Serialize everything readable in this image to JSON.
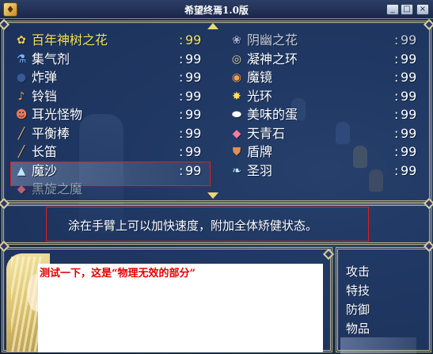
{
  "window": {
    "title": "希望终焉1.0版",
    "controls": [
      "_",
      "□",
      "×"
    ]
  },
  "items_left": [
    {
      "name": "百年神树之花",
      "count": "99",
      "icon": "flower-icon",
      "symbol": "✿",
      "state": "highlight"
    },
    {
      "name": "集气剂",
      "count": "99",
      "icon": "potion-icon",
      "symbol": "⚗",
      "state": "normal"
    },
    {
      "name": "炸弹",
      "count": "99",
      "icon": "bomb-icon",
      "symbol": "●",
      "state": "normal"
    },
    {
      "name": "铃铛",
      "count": "99",
      "icon": "bell-icon",
      "symbol": "♪",
      "state": "normal"
    },
    {
      "name": "耳光怪物",
      "count": "99",
      "icon": "monster-icon",
      "symbol": "☻",
      "state": "normal"
    },
    {
      "name": "平衡棒",
      "count": "99",
      "icon": "rod-icon",
      "symbol": "╱",
      "state": "normal"
    },
    {
      "name": "长笛",
      "count": "99",
      "icon": "flute-icon",
      "symbol": "╱",
      "state": "normal"
    },
    {
      "name": "魔沙",
      "count": "99",
      "icon": "sand-icon",
      "symbol": "▲",
      "state": "selected"
    },
    {
      "name": "黑旋之魔",
      "count": "",
      "icon": "item-icon",
      "symbol": "◆",
      "state": "partial"
    }
  ],
  "items_right": [
    {
      "name": "阴幽之花",
      "count": "99",
      "icon": "dark-flower-icon",
      "symbol": "❀",
      "state": "dim"
    },
    {
      "name": "凝神之环",
      "count": "99",
      "icon": "ring-icon",
      "symbol": "◎",
      "state": "normal"
    },
    {
      "name": "魔镜",
      "count": "99",
      "icon": "mirror-icon",
      "symbol": "◉",
      "state": "normal"
    },
    {
      "name": "光环",
      "count": "99",
      "icon": "halo-icon",
      "symbol": "✸",
      "state": "normal"
    },
    {
      "name": "美味的蛋",
      "count": "99",
      "icon": "egg-icon",
      "symbol": "⬬",
      "state": "normal"
    },
    {
      "name": "天青石",
      "count": "99",
      "icon": "gem-icon",
      "symbol": "◆",
      "state": "normal"
    },
    {
      "name": "盾牌",
      "count": "99",
      "icon": "shield-icon",
      "symbol": "⛊",
      "state": "normal"
    },
    {
      "name": "圣羽",
      "count": "99",
      "icon": "feather-icon",
      "symbol": "❧",
      "state": "normal"
    }
  ],
  "colon": ":",
  "description": "涂在手臂上可以加快速度，附加全体矫健状态。",
  "message": "测试一下，这是“物理无效的部分”",
  "commands": [
    {
      "label": "攻击"
    },
    {
      "label": "特技"
    },
    {
      "label": "防御"
    },
    {
      "label": "物品",
      "selected": true
    }
  ],
  "colors": {
    "highlight": "#f3e35b",
    "selection_border": "#e02020",
    "message_text": "#e00000",
    "panel": "#1e3769"
  }
}
